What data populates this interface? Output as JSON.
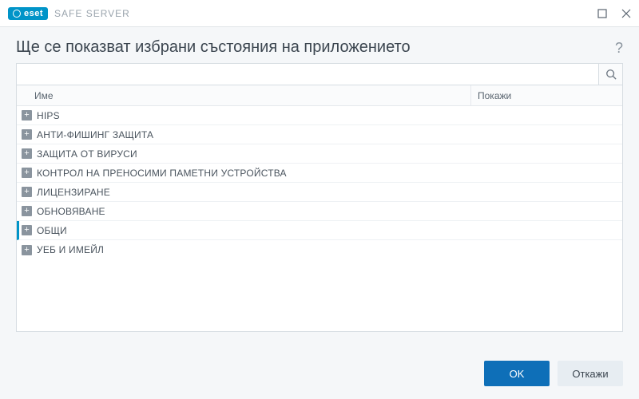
{
  "titlebar": {
    "brand": "eset",
    "product": "SAFE SERVER"
  },
  "header": {
    "title": "Ще се показват избрани състояния на приложението",
    "help": "?"
  },
  "search": {
    "placeholder": ""
  },
  "columns": {
    "name": "Име",
    "show": "Покажи"
  },
  "rows": [
    {
      "label": "HIPS",
      "selected": false
    },
    {
      "label": "АНТИ-ФИШИНГ ЗАЩИТА",
      "selected": false
    },
    {
      "label": "ЗАЩИТА ОТ ВИРУСИ",
      "selected": false
    },
    {
      "label": "КОНТРОЛ НА ПРЕНОСИМИ ПАМЕТНИ УСТРОЙСТВА",
      "selected": false
    },
    {
      "label": "ЛИЦЕНЗИРАНЕ",
      "selected": false
    },
    {
      "label": "ОБНОВЯВАНЕ",
      "selected": false
    },
    {
      "label": "ОБЩИ",
      "selected": true
    },
    {
      "label": "УЕБ И ИМЕЙЛ",
      "selected": false
    }
  ],
  "footer": {
    "ok": "OK",
    "cancel": "Откажи"
  }
}
